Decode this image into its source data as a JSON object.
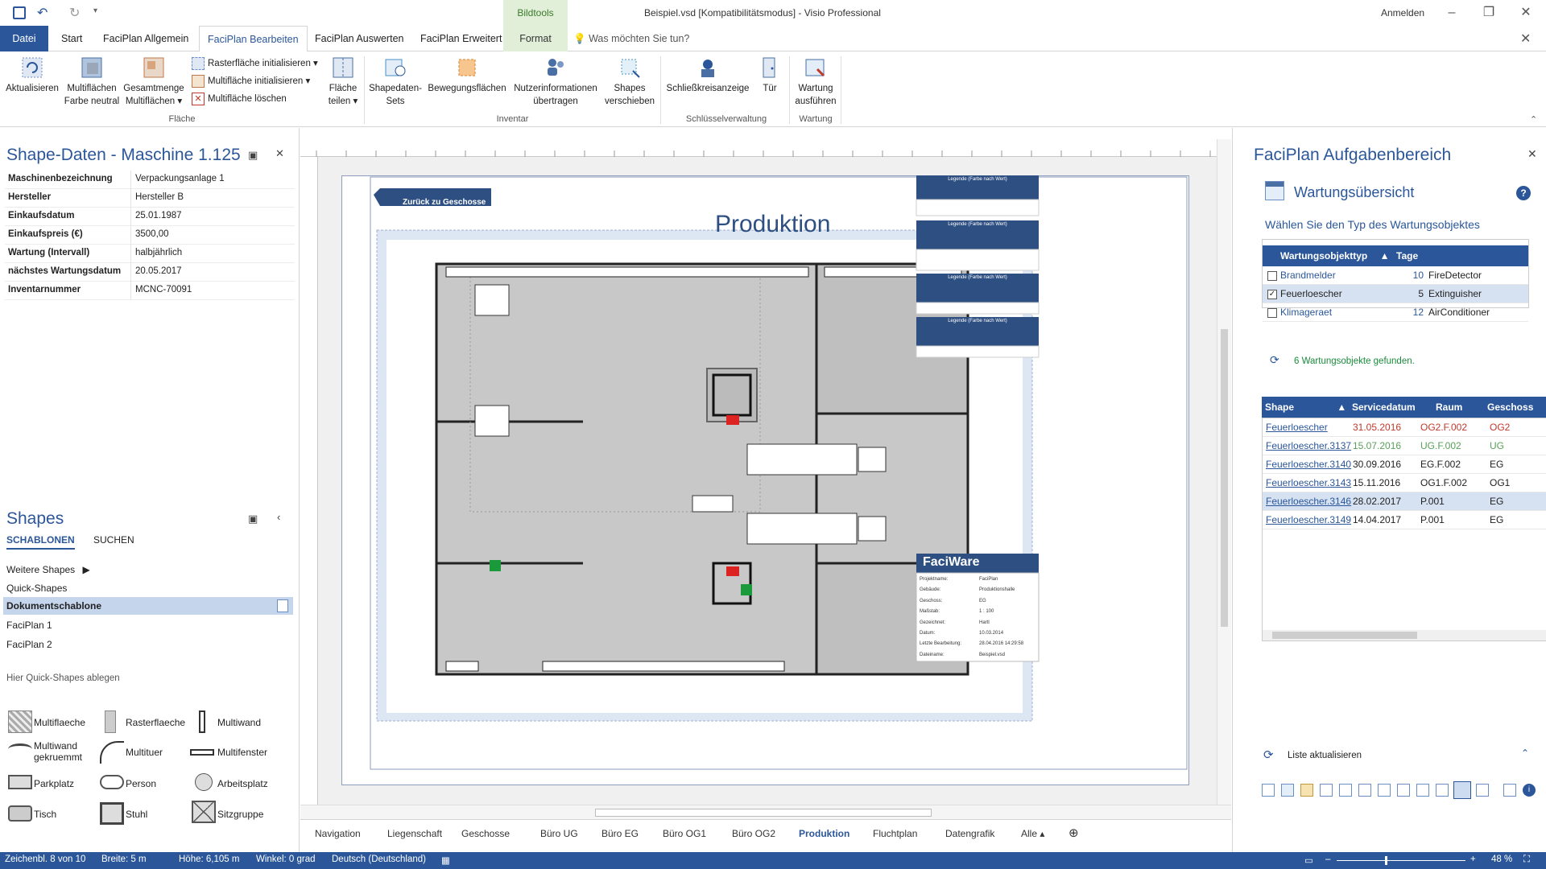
{
  "titlebar": {
    "context_tab": "Bildtools",
    "title": "Beispiel.vsd  [Kompatibilitätsmodus] - Visio Professional",
    "signin": "Anmelden"
  },
  "tabs": [
    "Datei",
    "Start",
    "FaciPlan Allgemein",
    "FaciPlan Bearbeiten",
    "FaciPlan Auswerten",
    "FaciPlan Erweitert",
    "Format"
  ],
  "tellme": "Was möchten Sie tun?",
  "ribbon": {
    "aktualisieren": "Aktualisieren",
    "multiflaechen_farbe": "Multiflächen",
    "multiflaechen_farbe2": "Farbe neutral",
    "gesamtmenge": "Gesamtmenge",
    "gesamtmenge2": "Multiflächen",
    "raster_init": "Rasterfläche initialisieren",
    "multi_init": "Multifläche initialisieren",
    "multi_loeschen": "Multifläche löschen",
    "flaeche_teilen": "Fläche",
    "flaeche_teilen2": "teilen",
    "grp_flaeche": "Fläche",
    "shapedaten_sets": "Shapedaten-",
    "shapedaten_sets2": "Sets",
    "bewegungsflaechen": "Bewegungsflächen",
    "nutzerinfo": "Nutzerinformationen",
    "nutzerinfo2": "übertragen",
    "shapes_verschieben": "Shapes",
    "shapes_verschieben2": "verschieben",
    "grp_inventar": "Inventar",
    "schliesskreis": "Schließkreisanzeige",
    "tuer": "Tür",
    "grp_schluessel": "Schlüsselverwaltung",
    "wartung": "Wartung",
    "wartung2": "ausführen",
    "grp_wartung": "Wartung"
  },
  "shape_data": {
    "title": "Shape-Daten - Maschine 1.125",
    "rows": [
      {
        "k": "Maschinenbezeichnung",
        "v": "Verpackungsanlage 1"
      },
      {
        "k": "Hersteller",
        "v": "Hersteller B"
      },
      {
        "k": "Einkaufsdatum",
        "v": "25.01.1987"
      },
      {
        "k": "Einkaufspreis (€)",
        "v": "3500,00"
      },
      {
        "k": "Wartung (Intervall)",
        "v": "halbjährlich"
      },
      {
        "k": "nächstes Wartungsdatum",
        "v": "20.05.2017"
      },
      {
        "k": "Inventarnummer",
        "v": "MCNC-70091"
      }
    ]
  },
  "shapes": {
    "title": "Shapes",
    "tab_schablonen": "SCHABLONEN",
    "tab_suchen": "SUCHEN",
    "items": [
      "Weitere Shapes",
      "Quick-Shapes",
      "Dokumentschablone",
      "FaciPlan 1",
      "FaciPlan 2"
    ],
    "drop_hint": "Hier Quick-Shapes ablegen",
    "stencils": [
      "Multiflaeche",
      "Rasterflaeche",
      "Multiwand",
      "Multiwand gekruemmt",
      "Multituer",
      "Multifenster",
      "Parkplatz",
      "Person",
      "Arbeitsplatz",
      "Tisch",
      "Stuhl",
      "Sitzgruppe"
    ]
  },
  "drawing": {
    "back_button": "Zurück zu Geschosse",
    "title": "Produktion",
    "logo": "FaciWare",
    "legend_header": "Legende (Farbe nach Wert)",
    "info_rows": [
      {
        "k": "Projektname:",
        "v": "FaciPlan"
      },
      {
        "k": "Gebäude:",
        "v": "Produktionshalle"
      },
      {
        "k": "Geschoss:",
        "v": "EG"
      },
      {
        "k": "Maßstab:",
        "v": "1 : 100"
      },
      {
        "k": "Gezeichnet:",
        "v": "Hartl"
      },
      {
        "k": "Datum:",
        "v": "10.03.2014"
      },
      {
        "k": "Letzte Bearbeitung:",
        "v": "28.04.2016 14:29:58"
      },
      {
        "k": "Dateiname:",
        "v": "Beispiel.vsd"
      }
    ]
  },
  "sheets": [
    "Navigation",
    "Liegenschaft",
    "Geschosse",
    "Büro UG",
    "Büro EG",
    "Büro OG1",
    "Büro OG2",
    "Produktion",
    "Fluchtplan",
    "Datengrafik",
    "Alle"
  ],
  "taskpane": {
    "title": "FaciPlan Aufgabenbereich",
    "section": "Wartungsübersicht",
    "prompt": "Wählen Sie den Typ des Wartungsobjektes",
    "col_typ": "Wartungsobjekttyp",
    "col_tage": "Tage",
    "types": [
      {
        "name": "Brandmelder",
        "days": "10",
        "en": "FireDetector",
        "checked": false
      },
      {
        "name": "Feuerloescher",
        "days": "5",
        "en": "Extinguisher",
        "checked": true
      },
      {
        "name": "Klimageraet",
        "days": "12",
        "en": "AirConditioner",
        "checked": false
      }
    ],
    "found": "6 Wartungsobjekte gefunden.",
    "cols": [
      "Shape",
      "Servicedatum",
      "Raum",
      "Geschoss"
    ],
    "items": [
      {
        "shape": "Feuerloescher",
        "date": "31.05.2016",
        "raum": "OG2.F.002",
        "geschoss": "OG2",
        "color": "#c0392b"
      },
      {
        "shape": "Feuerloescher.3137",
        "date": "15.07.2016",
        "raum": "UG.F.002",
        "geschoss": "UG",
        "color": "#5aa05a"
      },
      {
        "shape": "Feuerloescher.3140",
        "date": "30.09.2016",
        "raum": "EG.F.002",
        "geschoss": "EG",
        "color": "#222222"
      },
      {
        "shape": "Feuerloescher.3143",
        "date": "15.11.2016",
        "raum": "OG1.F.002",
        "geschoss": "OG1",
        "color": "#222222"
      },
      {
        "shape": "Feuerloescher.3146",
        "date": "28.02.2017",
        "raum": "P.001",
        "geschoss": "EG",
        "color": "#222222"
      },
      {
        "shape": "Feuerloescher.3149",
        "date": "14.04.2017",
        "raum": "P.001",
        "geschoss": "EG",
        "color": "#222222"
      }
    ],
    "refresh": "Liste aktualisieren"
  },
  "status": {
    "sheet": "Zeichenbl. 8 von 10",
    "width": "Breite: 5 m",
    "height": "Höhe: 6,105 m",
    "angle": "Winkel: 0 grad",
    "lang": "Deutsch (Deutschland)",
    "zoom": "48 %"
  },
  "colors": {
    "accent": "#2b579a",
    "context_green": "#e1efd9",
    "plan_gray": "#c8c8c8"
  }
}
